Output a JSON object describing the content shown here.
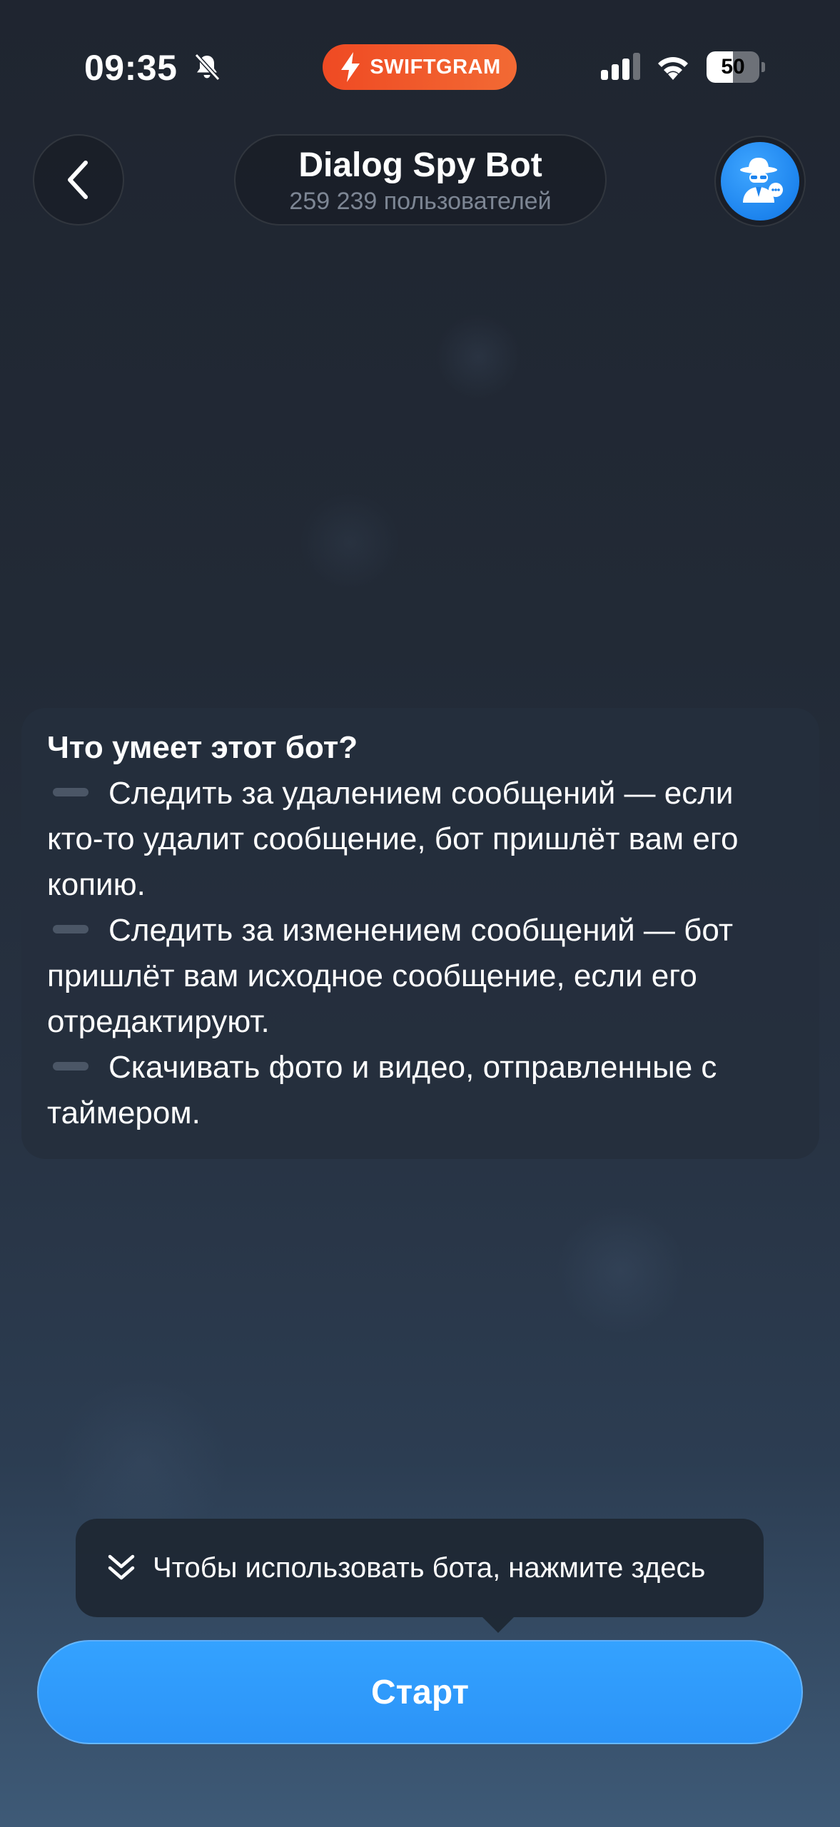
{
  "status_bar": {
    "time": "09:35",
    "app_badge": "SWIFTGRAM",
    "battery_level": 50,
    "battery_text": "50",
    "badge_color": "#ef4a23"
  },
  "header": {
    "title": "Dialog Spy Bot",
    "subtitle": "259 239 пользователей"
  },
  "info": {
    "title": "Что умеет этот бот?",
    "line1": "Следить за удалением сообщений — если кто-то удалит сообщение, бот пришлёт вам его копию.",
    "line2": "Следить за изменением сообщений — бот пришлёт вам исходное сообщение, если его отредактируют.",
    "line3": "Скачивать фото и видео, отправленные с таймером."
  },
  "tooltip": {
    "text": "Чтобы использовать бота, нажмите здесь"
  },
  "start_button": {
    "label": "Старт",
    "color": "#2f9bfb"
  },
  "icons": {
    "back": "chevron-left-icon",
    "bell": "bell-slash-icon",
    "bolt": "lightning-icon",
    "signal": "cellular-signal-icon",
    "wifi": "wifi-icon",
    "battery": "battery-icon",
    "avatar": "spy-agent-icon",
    "chevron": "double-chevron-down-icon"
  }
}
